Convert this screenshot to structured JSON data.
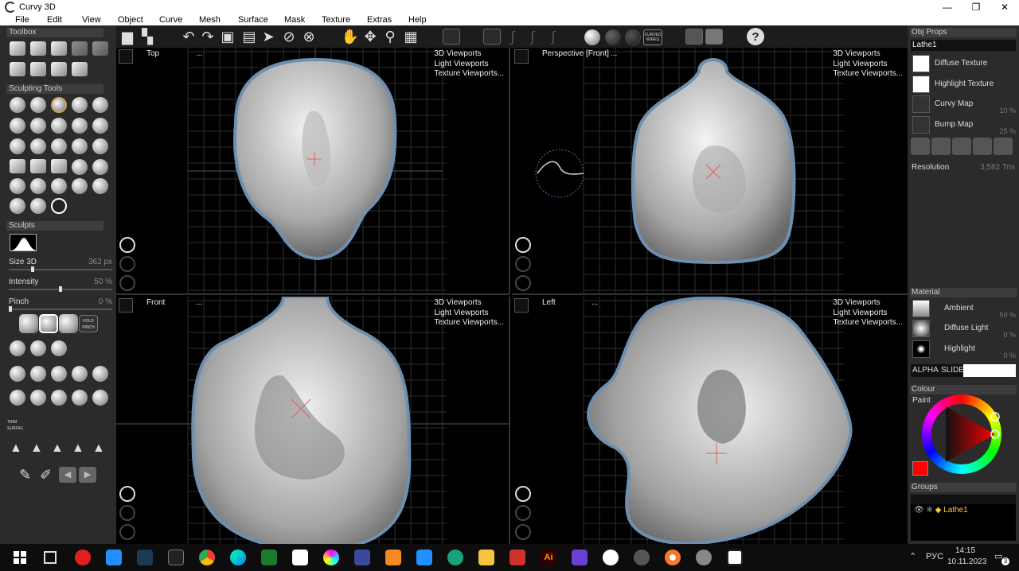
{
  "window": {
    "title": "Curvy 3D",
    "minimize": "—",
    "maximize": "❐",
    "close": "✕"
  },
  "menu": [
    "File",
    "Edit",
    "View",
    "Object",
    "Curve",
    "Mesh",
    "Surface",
    "Mask",
    "Texture",
    "Extras",
    "Help"
  ],
  "left_panel": {
    "toolbox_title": "Toolbox",
    "sculpting_title": "Sculpting Tools",
    "sculpts_title": "Sculpts",
    "size3d": {
      "label": "Size 3D",
      "value": "362 px",
      "fraction": 0.22
    },
    "intensity": {
      "label": "Intensity",
      "value": "50 %",
      "fraction": 0.5
    },
    "pinch": {
      "label": "Pinch",
      "value": "0 %",
      "fraction": 0.0
    },
    "fold_pinch": "FOLD PINCH",
    "trim_surface": "TRIM SURFAC"
  },
  "toolbar": {
    "curved_wires": "CURVED WIRES"
  },
  "viewports": [
    {
      "label": "Top",
      "dots": "...",
      "menu": [
        "3D Viewports",
        "Light Viewports",
        "Texture Viewports..."
      ]
    },
    {
      "label": "Perspective [Front]",
      "dots": "...",
      "menu": [
        "3D Viewports",
        "Light Viewports",
        "Texture Viewports..."
      ]
    },
    {
      "label": "Front",
      "dots": "...",
      "menu": [
        "3D Viewports",
        "Light Viewports",
        "Texture Viewports..."
      ]
    },
    {
      "label": "Left",
      "dots": "...",
      "menu": [
        "3D Viewports",
        "Light Viewports",
        "Texture Viewports..."
      ]
    }
  ],
  "right_panel": {
    "obj_props_title": "Obj Props",
    "object_name": "Lathe1",
    "diffuse_texture": "Diffuse Texture",
    "highlight_texture": "Highlight Texture",
    "curvy_map": {
      "label": "Curvy Map",
      "value": "10 %"
    },
    "bump_map": {
      "label": "Bump Map",
      "value": "25 %"
    },
    "resolution": {
      "label": "Resolution",
      "value": "3,582 Tris"
    },
    "material_title": "Material",
    "ambient": {
      "label": "Ambient",
      "value": "50 %"
    },
    "diffuse_light": {
      "label": "Diffuse Light",
      "value": "0 %"
    },
    "highlight": {
      "label": "Highlight",
      "value": "0 %"
    },
    "alpha": "ALPHA",
    "sliders": "SLIDERS",
    "colour_title": "Colour",
    "paint": "Paint",
    "paint_color": "#ff0000",
    "groups_title": "Groups",
    "group_item": "Lathe1"
  },
  "taskbar": {
    "lang": "РУС",
    "time": "14:15",
    "date": "10.11.2023",
    "notifications": "3"
  }
}
